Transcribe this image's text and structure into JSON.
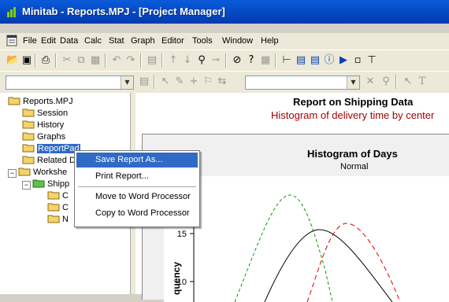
{
  "window": {
    "title": "Minitab - Reports.MPJ - [Project Manager]"
  },
  "menu": [
    "File",
    "Edit",
    "Data",
    "Calc",
    "Stat",
    "Graph",
    "Editor",
    "Tools",
    "Window",
    "Help"
  ],
  "tree": {
    "root": "Reports.MPJ",
    "items": [
      "Session",
      "History",
      "Graphs",
      "ReportPad",
      "Related D",
      "Workshe",
      "Shipp",
      "C",
      "C",
      "N"
    ]
  },
  "context_menu": {
    "items": [
      "Save Report As...",
      "Print Report...",
      "Move to Word Processor",
      "Copy to Word Processor"
    ]
  },
  "report": {
    "title": "Report on Shipping Data",
    "subtitle": "Histogram of delivery time by center"
  },
  "graph": {
    "title": "Histogram of Days",
    "subtitle": "Normal",
    "ylabel": "quency",
    "yticks": [
      "15",
      "10"
    ]
  },
  "chart_data": {
    "type": "line",
    "title": "Histogram of Days",
    "subtitle": "Normal",
    "ylabel": "quency",
    "yticks": [
      15,
      10
    ],
    "series": [
      {
        "style": "dashed",
        "color": "#00a000"
      },
      {
        "style": "solid",
        "color": "#000000"
      },
      {
        "style": "dashed",
        "color": "#e00000"
      }
    ]
  }
}
